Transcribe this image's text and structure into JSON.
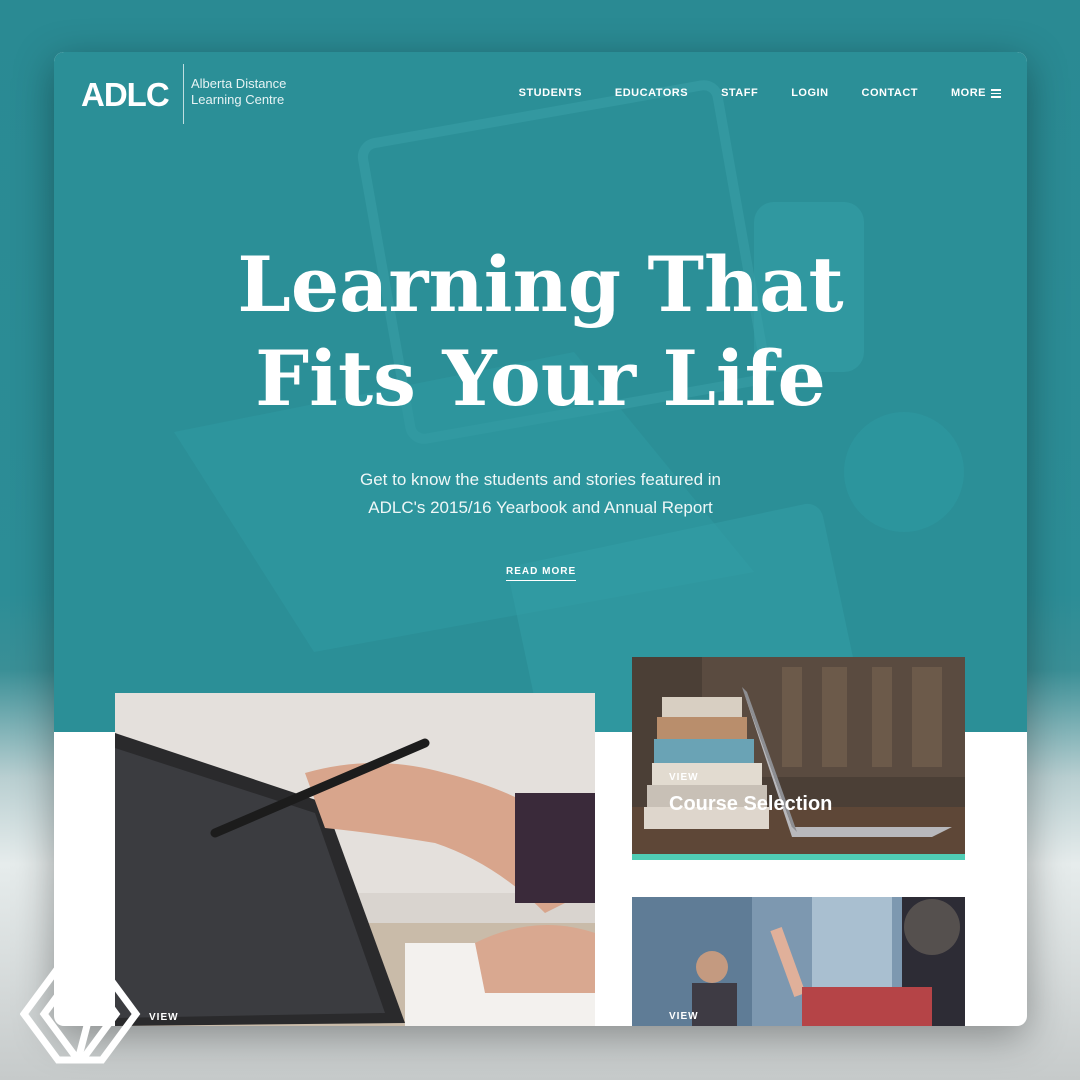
{
  "brand": {
    "logo_text": "ADLC",
    "logo_subtitle": "Alberta Distance Learning Centre"
  },
  "nav": {
    "items": [
      {
        "label": "STUDENTS"
      },
      {
        "label": "EDUCATORS"
      },
      {
        "label": "STAFF"
      },
      {
        "label": "LOGIN"
      },
      {
        "label": "CONTACT"
      }
    ],
    "more_label": "MORE"
  },
  "hero": {
    "headline_line1": "Learning That",
    "headline_line2": "Fits Your Life",
    "subtext_line1": "Get to know the students and stories featured in",
    "subtext_line2": "ADLC's 2015/16 Yearbook and Annual Report",
    "cta_label": "READ MORE"
  },
  "cards": {
    "large": {
      "label": "VIEW"
    },
    "small1": {
      "label": "VIEW",
      "title": "Course Selection"
    },
    "small2": {
      "label": "VIEW"
    }
  },
  "colors": {
    "hero_teal": "#2b8f97",
    "accent_green": "#4fcdb4"
  }
}
